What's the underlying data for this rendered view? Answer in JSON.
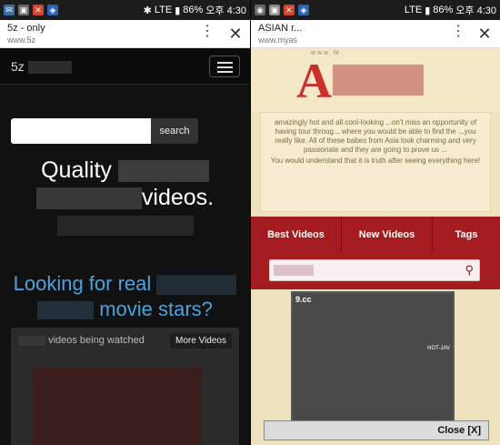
{
  "left": {
    "status": {
      "network": "LTE",
      "battery": "86%",
      "time": "오후 4:30"
    },
    "urlbar": {
      "title": "5z - only",
      "host": "www.5z"
    },
    "nav": {
      "brand": "5z"
    },
    "search": {
      "button": "search",
      "placeholder": ""
    },
    "hero": {
      "line1": "Quality",
      "line2": "videos."
    },
    "tagline": {
      "line1": "Looking for real",
      "line2": "movie stars?"
    },
    "panel": {
      "heading": "videos being watched",
      "more": "More Videos"
    }
  },
  "right": {
    "status": {
      "network": "LTE",
      "battery": "86%",
      "time": "오후 4:30"
    },
    "urlbar": {
      "title": "ASIAN r...",
      "host": "www.myas"
    },
    "logo": {
      "letter": "A",
      "tagline": "w w w . M"
    },
    "intro": {
      "text": "amazingly hot and all cool-looking ...on't miss an opportunity of having tour throug... where you would be able to find the ...you really like. All of these babes from Asia look charming and very passionate and they are going to prove us ...",
      "tail": "You would understand that it is truth after seeing everything here!"
    },
    "tabs": [
      "Best Videos",
      "New Videos",
      "Tags"
    ],
    "thumb": {
      "tag": "9.cc",
      "tag2": "HOT-JAV"
    },
    "close": "Close [X]"
  },
  "colors": {
    "accent_blue": "#4aa3e0",
    "accent_red": "#a41c1f",
    "bg_cream": "#efe3bd"
  }
}
